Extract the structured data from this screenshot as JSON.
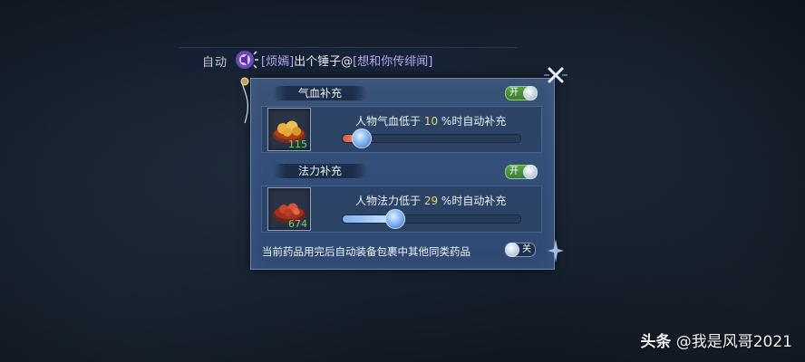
{
  "chat": {
    "prefix": "自动",
    "link1": "[烦嫣]",
    "message": "出个锤子@",
    "link2": "[想和你传绯闻]"
  },
  "panel": {
    "hp_section": {
      "title": "气血补充",
      "toggle_label": "开",
      "item_count": "115",
      "label_before": "人物气血低于 ",
      "threshold": "10",
      "label_after": " %时自动补充",
      "slider_fraction": 0.1
    },
    "mp_section": {
      "title": "法力补充",
      "toggle_label": "开",
      "item_count": "674",
      "label_before": "人物法力低于 ",
      "threshold": "29",
      "label_after": " %时自动补充",
      "slider_fraction": 0.29
    },
    "auto_equip": {
      "text": "当前药品用完后自动装备包裹中其他同类药品",
      "toggle_label": "关"
    }
  },
  "icons": {
    "speaker": "speaker-icon",
    "close": "close-icon",
    "hp_potion": "food-bowl-icon",
    "mp_potion": "food-bowl-icon"
  },
  "colors": {
    "threshold": "#f2d25a",
    "count": "#6fd36a",
    "link": "#b8a6f0",
    "toggle_on": "#58a24a"
  },
  "watermark": {
    "brand": "头条",
    "handle": "@我是风哥2021"
  }
}
